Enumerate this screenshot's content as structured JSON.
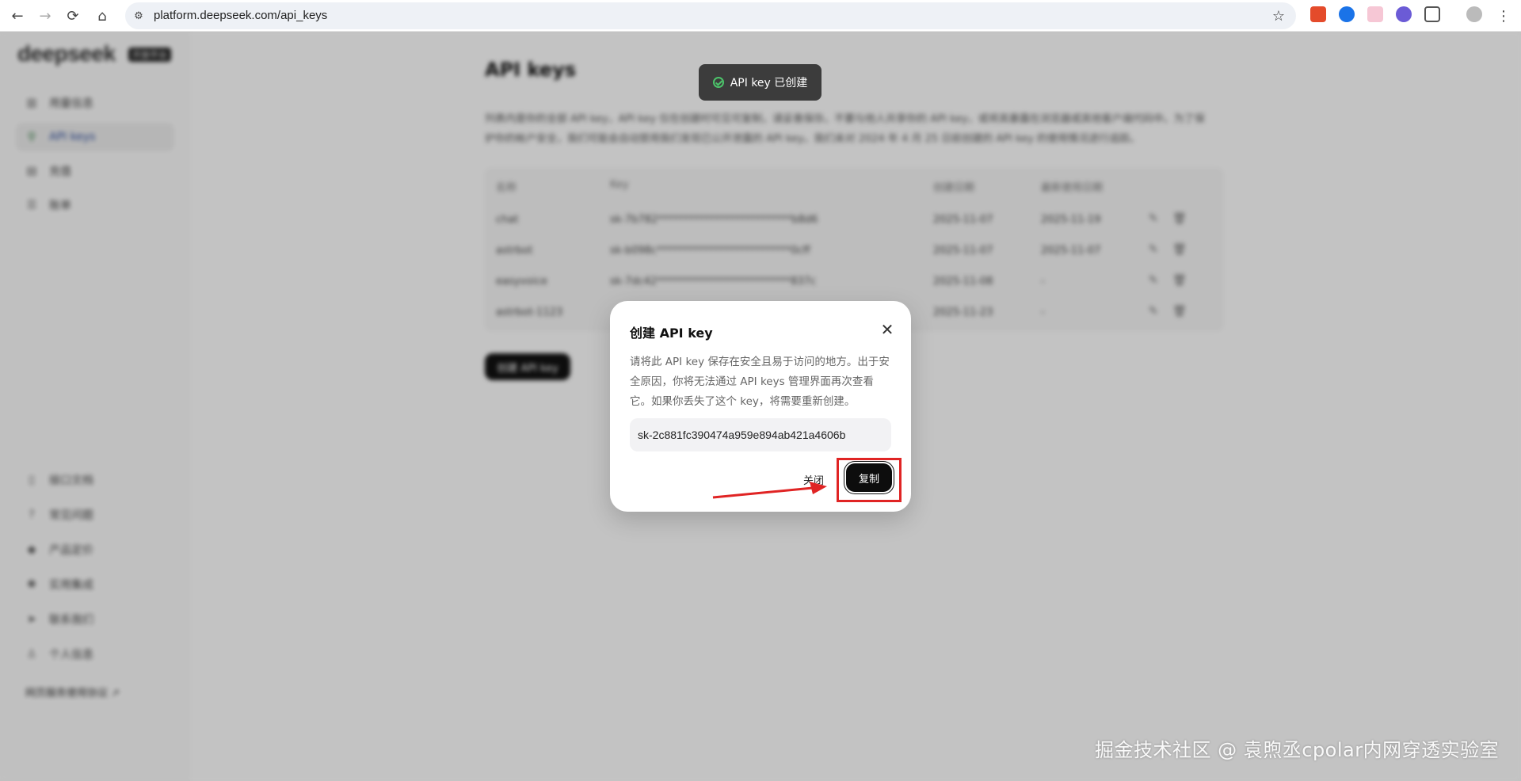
{
  "browser": {
    "url": "platform.deepseek.com/api_keys",
    "back_icon": "←",
    "forward_icon": "→",
    "reload_icon": "⟳",
    "home_icon": "⌂",
    "star_icon": "☆",
    "menu_icon": "⋮"
  },
  "brand": {
    "logo": "deepseek",
    "badge": "开放平台"
  },
  "sidebar": {
    "items": [
      {
        "label": "用量信息",
        "icon": "chart-icon"
      },
      {
        "label": "API keys",
        "icon": "search-icon"
      },
      {
        "label": "充值",
        "icon": "wallet-icon"
      },
      {
        "label": "账单",
        "icon": "bill-icon"
      }
    ],
    "bottom_items": [
      {
        "label": "接口文档",
        "icon": "doc-icon"
      },
      {
        "label": "常见问题",
        "icon": "question-icon"
      },
      {
        "label": "产品定价",
        "icon": "tag-icon"
      },
      {
        "label": "实用集成",
        "icon": "plug-icon"
      },
      {
        "label": "联系我们",
        "icon": "send-icon"
      },
      {
        "label": "个人信息",
        "icon": "user-icon"
      }
    ],
    "feedback_link": "网页服务使用协议 ↗"
  },
  "main": {
    "title": "API keys",
    "description": "列表内是你的全部 API key，API key 仅在创建时可见可复制，请妥善保存。不要与他人共享你的 API key，或将其暴露在浏览器或其他客户端代码中。为了保护你的帐户安全，我们可能会自动禁用我们发现已公开泄露的 API key。我们未对 2024 年 4 月 25 日前创建的 API key 的使用情况进行追踪。",
    "table": {
      "headers": [
        "名称",
        "Key",
        "创建日期",
        "最新使用日期"
      ],
      "rows": [
        {
          "name": "chat",
          "key": "sk-7b782**************************b8d6",
          "created": "2025-11-07",
          "last_used": "2025-11-19"
        },
        {
          "name": "astrbot",
          "key": "sk-b098c**************************0cff",
          "created": "2025-11-07",
          "last_used": "2025-11-07"
        },
        {
          "name": "easyvoice",
          "key": "sk-7dc42**************************837c",
          "created": "2025-11-08",
          "last_used": "-"
        },
        {
          "name": "astrbot-1123",
          "key": "",
          "created": "2025-11-23",
          "last_used": "-"
        }
      ]
    },
    "create_button": "创建 API key"
  },
  "toast": {
    "text": "API key 已创建"
  },
  "modal": {
    "title": "创建 API key",
    "body": "请将此 API key 保存在安全且易于访问的地方。出于安全原因，你将无法通过 API keys 管理界面再次查看它。如果你丢失了这个 key，将需要重新创建。",
    "api_key": "sk-2c881fc390474a959e894ab421a4606b",
    "close_label": "关闭",
    "copy_label": "复制"
  },
  "watermark": "掘金技术社区 @ 袁煦丞cpolar内网穿透实验室",
  "colors": {
    "highlight": "#e02424",
    "toast_check": "#4cc36a",
    "primary_button": "#0d0d0d"
  }
}
